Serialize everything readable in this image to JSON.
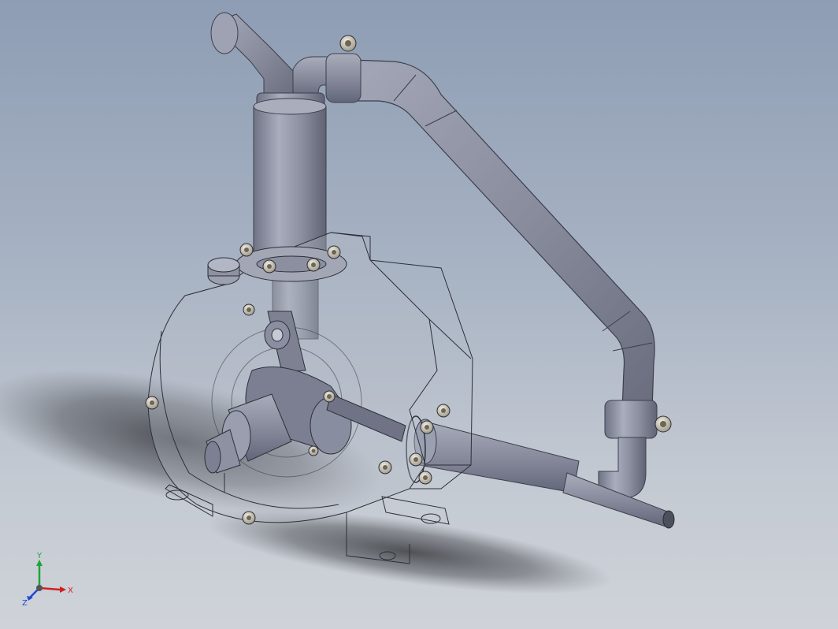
{
  "viewport": {
    "background_top": "#8e9db4",
    "background_bottom": "#cfd3d9"
  },
  "model": {
    "pipe_color": "#8f93a4",
    "pipe_shade": "#6b6f80",
    "pipe_highlight": "#b8bccb",
    "housing_edge": "#2d2f38",
    "fastener_color": "#d8d2c0"
  },
  "triad": {
    "x_label": "X",
    "y_label": "Y",
    "z_label": "Z",
    "x_color": "#d22020",
    "y_color": "#1fa43a",
    "z_color": "#2046d2"
  }
}
